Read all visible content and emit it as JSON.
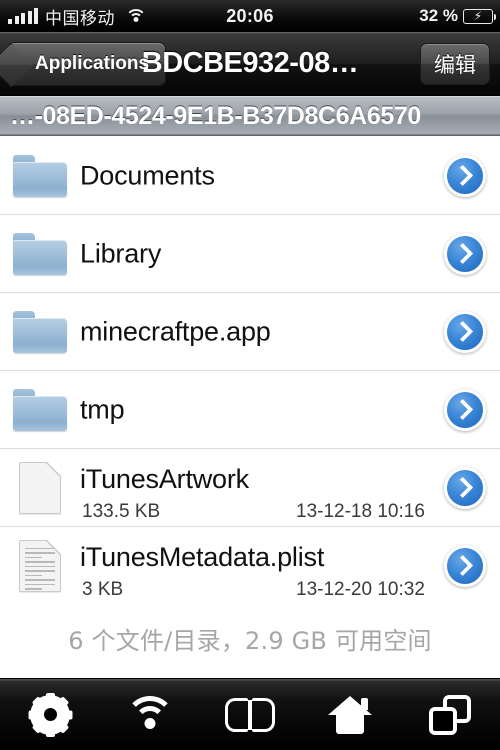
{
  "status_bar": {
    "carrier": "中国移动",
    "signal_bars": 5,
    "wifi_icon": "wifi-icon",
    "time": "20:06",
    "battery_percent": "32 %",
    "battery_icon": "battery-charging-icon"
  },
  "nav_bar": {
    "back_label": "Applications",
    "title": "BDCBE932-08…",
    "edit_label": "编辑"
  },
  "path_bar": {
    "path": "…-08ED-4524-9E1B-B37D8C6A6570"
  },
  "list": {
    "rows": [
      {
        "name": "Documents",
        "type": "folder",
        "icon": "folder-icon",
        "size": "",
        "date": "",
        "disclosure": "chevron-right-icon"
      },
      {
        "name": "Library",
        "type": "folder",
        "icon": "folder-icon",
        "size": "",
        "date": "",
        "disclosure": "chevron-right-icon"
      },
      {
        "name": "minecraftpe.app",
        "type": "folder",
        "icon": "folder-icon",
        "size": "",
        "date": "",
        "disclosure": "chevron-right-icon"
      },
      {
        "name": "tmp",
        "type": "folder",
        "icon": "folder-icon",
        "size": "",
        "date": "",
        "disclosure": "chevron-right-icon"
      },
      {
        "name": "iTunesArtwork",
        "type": "file",
        "icon": "blank-document-icon",
        "size": "133.5 KB",
        "date": "13-12-18 10:16",
        "disclosure": "chevron-right-icon"
      },
      {
        "name": "iTunesMetadata.plist",
        "type": "file",
        "icon": "text-document-icon",
        "size": "3 KB",
        "date": "13-12-20 10:32",
        "disclosure": "chevron-right-icon"
      }
    ]
  },
  "footer": {
    "summary": "6 个文件/目录，2.9 GB 可用空间"
  },
  "toolbar": {
    "items": [
      {
        "name": "settings",
        "icon": "gear-icon"
      },
      {
        "name": "network",
        "icon": "wifi-icon"
      },
      {
        "name": "bookmarks",
        "icon": "book-icon"
      },
      {
        "name": "home",
        "icon": "home-icon"
      },
      {
        "name": "windows",
        "icon": "copy-windows-icon"
      }
    ]
  },
  "colors": {
    "accent_blue": "#2d7ad4",
    "folder_blue": "#9dbdd8",
    "bar_dark": "#101010",
    "path_gray": "#9ba1a8",
    "footer_gray": "#a6a6a6"
  }
}
